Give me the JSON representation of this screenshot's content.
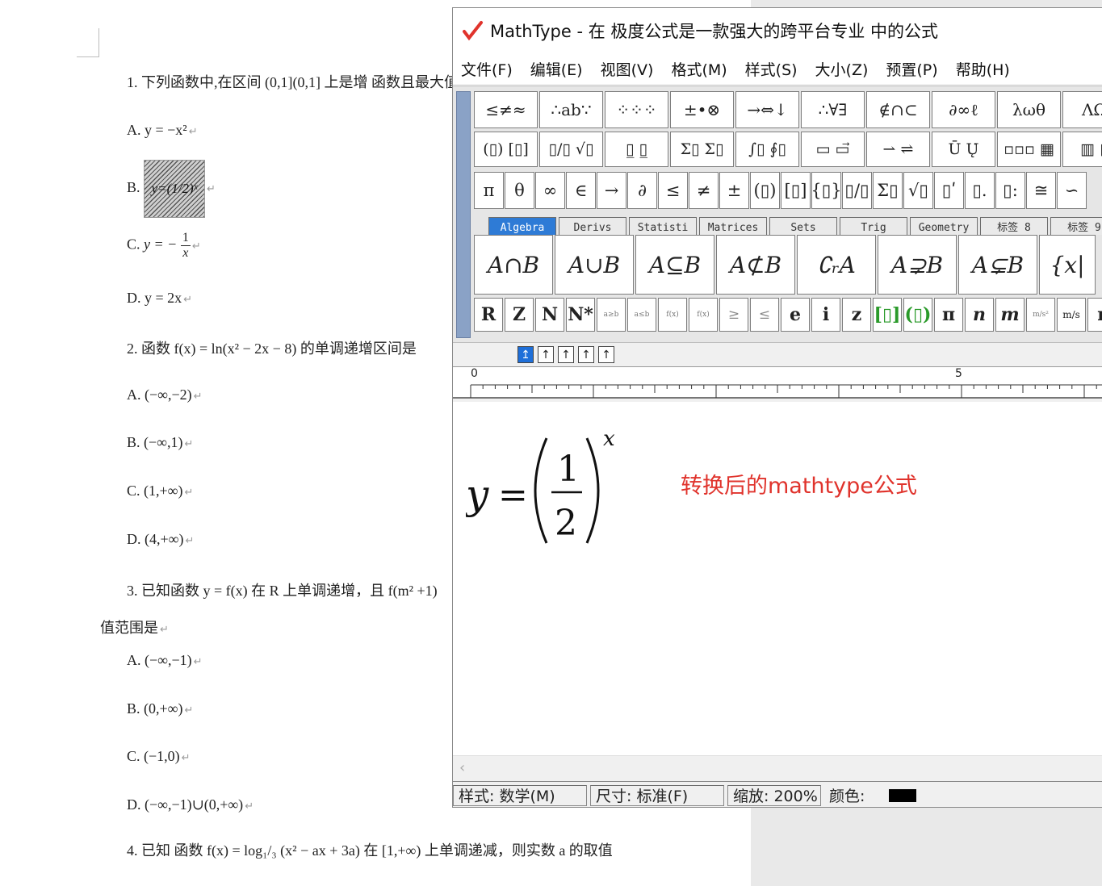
{
  "document": {
    "lines": [
      {
        "text": "1.  下列函数中,在区间  (0,1](0,1]  上是增  函数且最大值"
      },
      {
        "text": "A.  y = −x²"
      },
      {
        "label": "B.",
        "formula": "y=(1/2)ˣ"
      },
      {
        "label": "C.",
        "pre": "y = −",
        "num": "1",
        "den": "x"
      },
      {
        "text": "D.  y = 2x"
      },
      {
        "text": "2.  函数   f(x) = ln(x² − 2x − 8)   的单调递增区间是"
      },
      {
        "text": "A.  (−∞,−2)"
      },
      {
        "text": "B.  (−∞,1)"
      },
      {
        "text": "C.  (1,+∞)"
      },
      {
        "text": "D.  (4,+∞)"
      },
      {
        "text": "3.  已知函数   y = f(x) 在 R 上单调递增，且 f(m² +1)"
      },
      {
        "text": "值范围是"
      },
      {
        "text": "A.  (−∞,−1)"
      },
      {
        "text": "B.  (0,+∞)"
      },
      {
        "text": "C.  (−1,0)"
      },
      {
        "text": "D.  (−∞,−1)∪(0,+∞)"
      },
      {
        "text": "4.  已知  函数   f(x) = log₁/₃ (x² − ax + 3a)   在  [1,+∞)   上单调递减，则实数 a 的取值"
      }
    ],
    "para_mark": "↵"
  },
  "mathtype": {
    "title": "MathType - 在 极度公式是一款强大的跨平台专业 中的公式",
    "menu": [
      "文件(F)",
      "编辑(E)",
      "视图(V)",
      "格式(M)",
      "样式(S)",
      "大小(Z)",
      "预置(P)",
      "帮助(H)"
    ],
    "palette_row1": [
      "≤≠≈",
      "∴ab∵",
      "⁘⁘⁘",
      "±•⊗",
      "→⇔↓",
      "∴∀∃",
      "∉∩⊂",
      "∂∞ℓ",
      "λωθ",
      "ΛΩ"
    ],
    "palette_row2": [
      "(▯) [▯]",
      "▯/▯ √▯",
      "▯̲ ▯̲",
      "Σ▯ Σ▯",
      "∫▯ ∮▯",
      "▭ ▭⃗",
      "⇀ ⇌",
      "Ū Ų̇",
      "▫▫▫ ▦",
      "▥ ▯"
    ],
    "palette_row3": [
      "π",
      "θ",
      "∞",
      "∈",
      "→",
      "∂",
      "≤",
      "≠",
      "±",
      "(▯)",
      "[▯]",
      "{▯}",
      "▯/▯",
      "Σ▯",
      "√▯",
      "▯ʹ",
      "▯.",
      "▯:",
      "≅",
      "∽"
    ],
    "tabs": [
      "Algebra",
      "Derivs",
      "Statisti",
      "Matrices",
      "Sets",
      "Trig",
      "Geometry",
      "标签 8",
      "标签 9"
    ],
    "active_tab": "Algebra",
    "palette_row4": [
      "A∩B",
      "A∪B",
      "A⊆B",
      "A⊄B",
      "∁ᵣA",
      "A⊋B",
      "A⊊B",
      "{x|"
    ],
    "palette_row5": [
      "R",
      "Z",
      "N",
      "N*",
      "a≥b",
      "a≤b",
      "f(x)",
      "f(x)",
      "≥",
      "≤",
      "e",
      "i",
      "z",
      "[▯]",
      "(▯)",
      "π",
      "n",
      "m",
      "m/s²",
      "m/s",
      "r"
    ],
    "tab_buttons": [
      "↥",
      "↑",
      "↑",
      "↑",
      "↑"
    ],
    "ruler_labels": [
      "0",
      "5"
    ],
    "formula": {
      "lhs": "y",
      "eq": "=",
      "num": "1",
      "den": "2",
      "exp": "x"
    },
    "note": "转换后的mathtype公式",
    "status": {
      "style": "样式: 数学(M)",
      "size": "尺寸: 标准(F)",
      "zoom": "缩放: 200%",
      "color": "颜色:"
    },
    "accent_color": "#e0332c"
  }
}
